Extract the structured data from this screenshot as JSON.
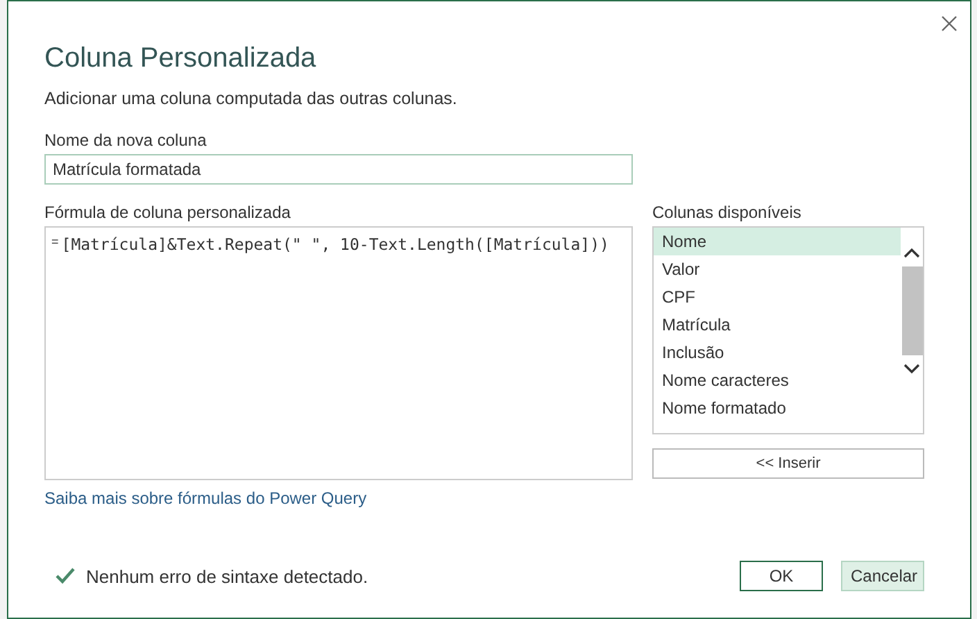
{
  "dialog": {
    "title": "Coluna Personalizada",
    "subtitle": "Adicionar uma coluna computada das outras colunas.",
    "name_field": {
      "label": "Nome da nova coluna",
      "value": "Matrícula formatada"
    },
    "formula_field": {
      "label": "Fórmula de coluna personalizada",
      "prefix": "=",
      "value": "[Matrícula]&Text.Repeat(\" \", 10-Text.Length([Matrícula]))"
    },
    "columns": {
      "label": "Colunas disponíveis",
      "items": [
        {
          "label": "Nome",
          "selected": true
        },
        {
          "label": "Valor",
          "selected": false
        },
        {
          "label": "CPF",
          "selected": false
        },
        {
          "label": "Matrícula",
          "selected": false
        },
        {
          "label": "Inclusão",
          "selected": false
        },
        {
          "label": "Nome caracteres",
          "selected": false
        },
        {
          "label": "Nome formatado",
          "selected": false
        }
      ],
      "insert_button": "<< Inserir"
    },
    "help_link": "Saiba mais sobre fórmulas do Power Query",
    "status": "Nenhum erro de sintaxe detectado.",
    "buttons": [
      {
        "label": "OK",
        "kind": "primary"
      },
      {
        "label": "Cancelar",
        "kind": "secondary"
      }
    ]
  }
}
